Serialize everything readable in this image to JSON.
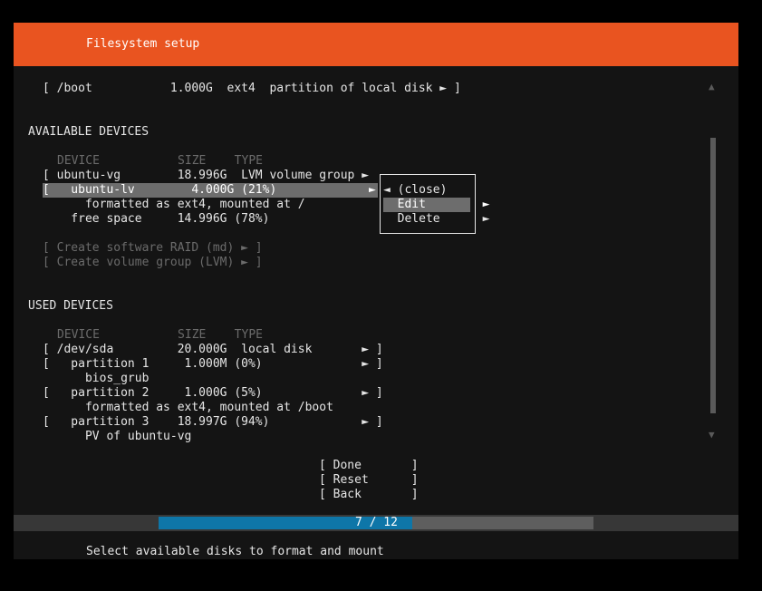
{
  "header": {
    "title": "Filesystem setup"
  },
  "top": {
    "boot_line": "[ /boot           1.000G  ext4  partition of local disk ► ]"
  },
  "available": {
    "heading": "AVAILABLE DEVICES",
    "columns": "DEVICE           SIZE    TYPE",
    "rows": [
      "[ ubuntu-vg        18.996G  LVM volume group ►",
      "[   ubuntu-lv        4.000G (21%)             ►",
      "      formatted as ext4, mounted at /",
      "    free space     14.996G (78%)"
    ],
    "actions": [
      "[ Create software RAID (md) ► ]",
      "[ Create volume group (LVM) ► ]"
    ]
  },
  "used": {
    "heading": "USED DEVICES",
    "columns": "DEVICE           SIZE    TYPE",
    "rows": [
      "[ /dev/sda         20.000G  local disk       ► ]",
      "[   partition 1     1.000M (0%)              ► ]",
      "      bios_grub",
      "[   partition 2     1.000G (5%)              ► ]",
      "      formatted as ext4, mounted at /boot",
      "[   partition 3    18.997G (94%)             ► ]",
      "      PV of ubuntu-vg"
    ]
  },
  "context_menu": {
    "close": "◄ (close)",
    "edit": "  Edit        ►",
    "delete": "  Delete      ►"
  },
  "buttons": {
    "done": "[ Done       ]",
    "reset": "[ Reset      ]",
    "back": "[ Back       ]"
  },
  "progress": {
    "text": "7 / 12",
    "current": 7,
    "total": 12
  },
  "footer": {
    "status": "Select available disks to format and mount"
  },
  "scroll": {
    "up": "▲",
    "down": "▼"
  },
  "colors": {
    "accent": "#e95420",
    "progress": "#0e76a8",
    "selection": "#6d6d6d"
  }
}
